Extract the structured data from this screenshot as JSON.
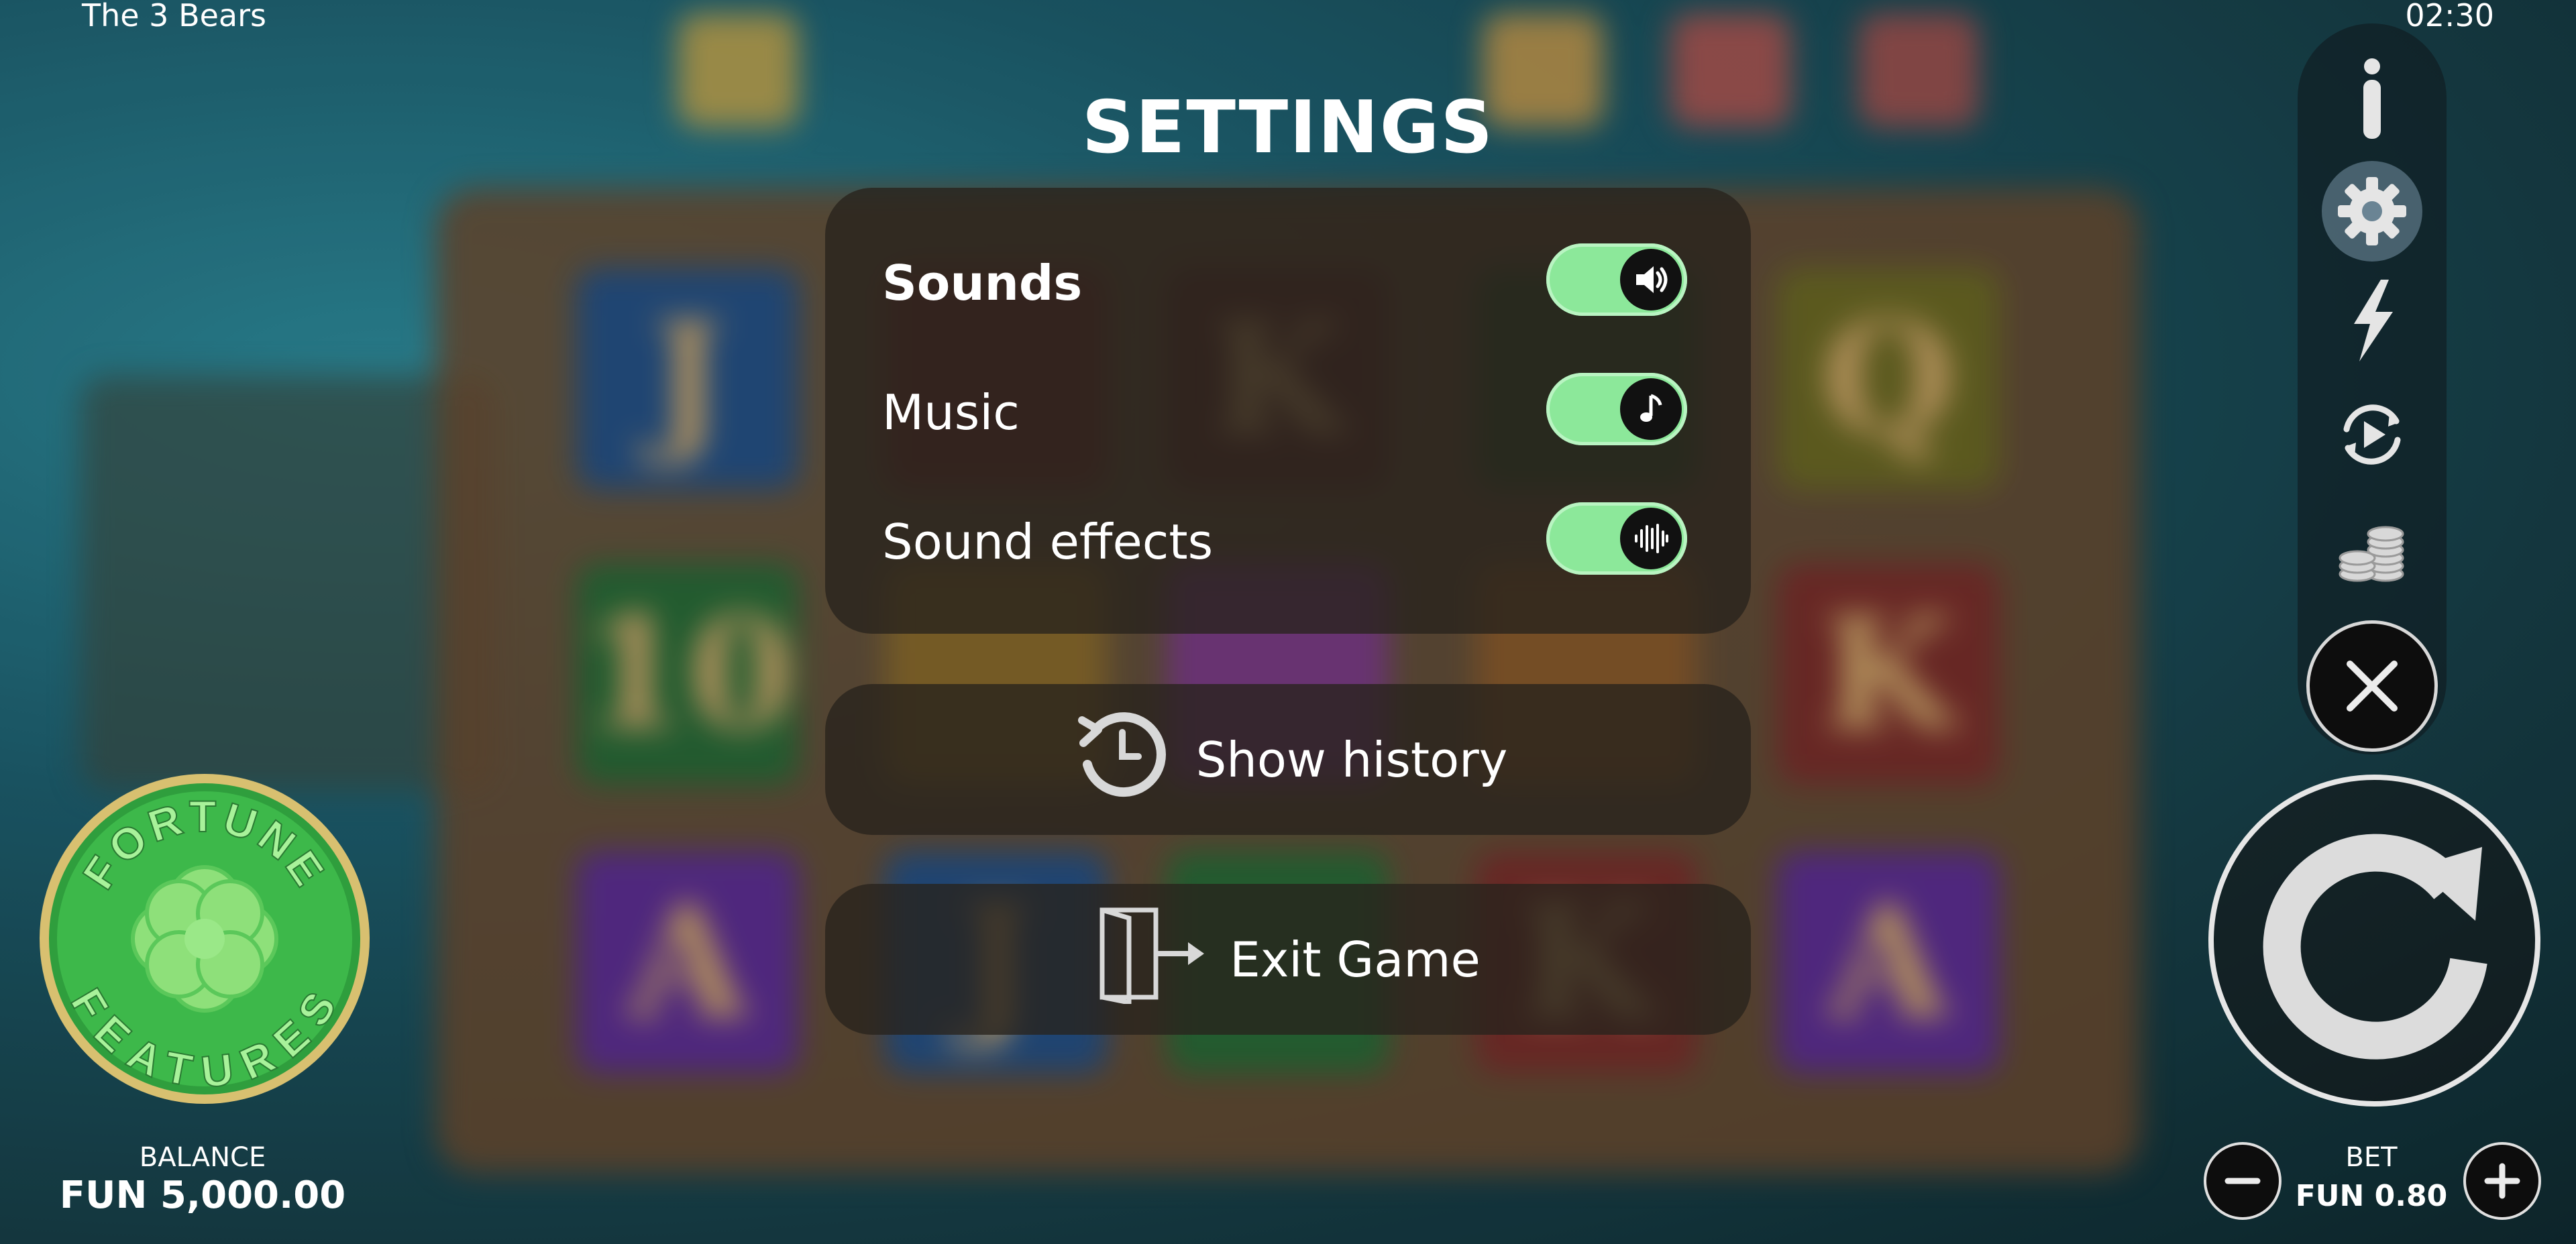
{
  "game": {
    "title": "The 3 Bears",
    "clock": "02:30"
  },
  "settings": {
    "title": "SETTINGS",
    "toggles": [
      {
        "label": "Sounds",
        "enabled": true,
        "icon": "speaker-icon"
      },
      {
        "label": "Music",
        "enabled": true,
        "icon": "music-note-icon"
      },
      {
        "label": "Sound effects",
        "enabled": true,
        "icon": "sound-wave-icon"
      }
    ],
    "history_label": "Show history",
    "exit_label": "Exit Game"
  },
  "toolbar": {
    "icons": [
      "info-icon",
      "settings-gear-icon",
      "lightning-icon",
      "autoplay-icon",
      "coins-icon",
      "close-icon"
    ],
    "active": "settings-gear-icon"
  },
  "fortune": {
    "top_text": "FORTUNE",
    "bottom_text": "FEATURES"
  },
  "balance": {
    "label": "BALANCE",
    "value": "FUN 5,000.00"
  },
  "bet": {
    "label": "BET",
    "value": "FUN 0.80"
  },
  "colors": {
    "toggle_on": "#8ce89a",
    "panel": "#28221c",
    "fortune_green": "#3db84a"
  }
}
